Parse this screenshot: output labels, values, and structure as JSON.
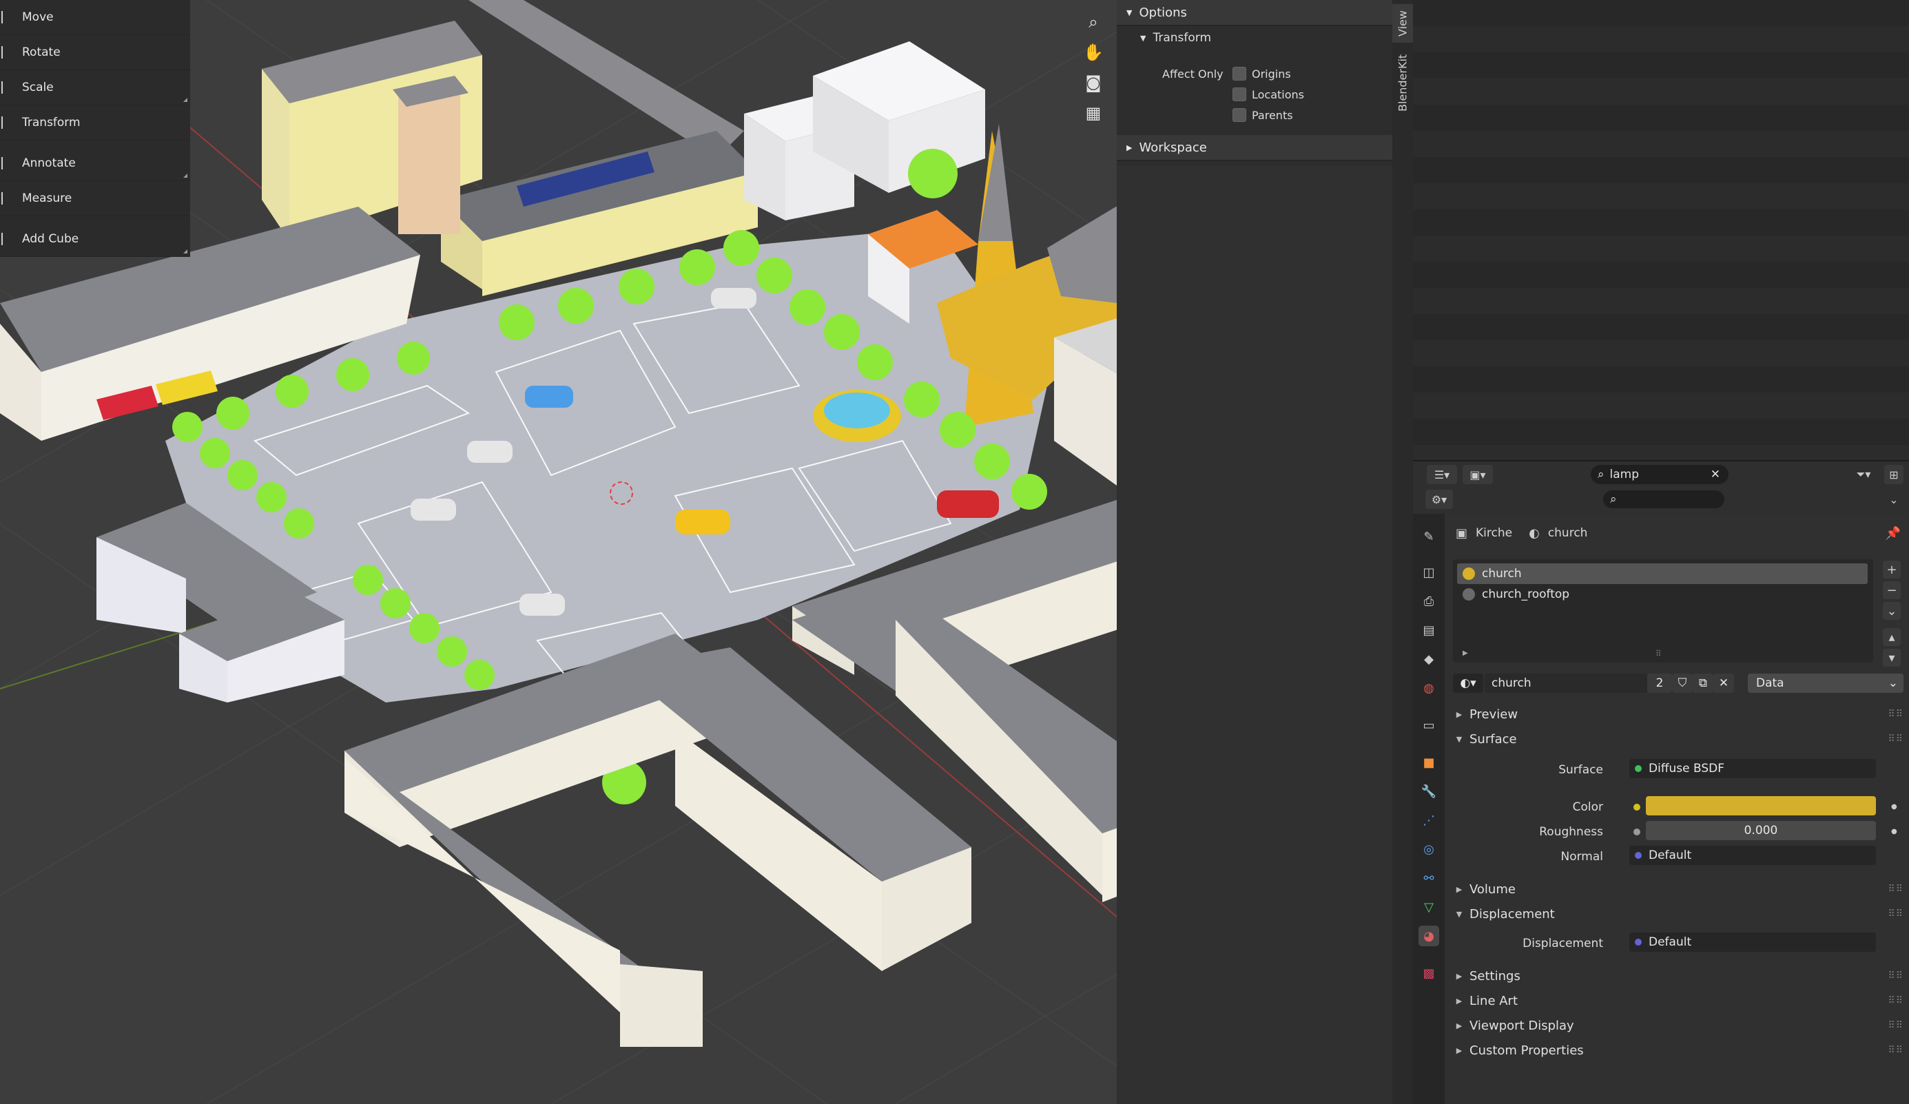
{
  "toolbar": {
    "tools": [
      {
        "label": "Move"
      },
      {
        "label": "Rotate"
      },
      {
        "label": "Scale"
      },
      {
        "label": "Transform"
      },
      {
        "label": "Annotate"
      },
      {
        "label": "Measure"
      },
      {
        "label": "Add Cube"
      }
    ]
  },
  "npanel": {
    "options_label": "Options",
    "transform_label": "Transform",
    "affect_only_label": "Affect Only",
    "checkboxes": [
      {
        "label": "Origins",
        "checked": false
      },
      {
        "label": "Locations",
        "checked": false
      },
      {
        "label": "Parents",
        "checked": false
      }
    ],
    "workspace_label": "Workspace",
    "tabs": [
      "View",
      "BlenderKit"
    ]
  },
  "outliner": {
    "search_value": "lamp"
  },
  "properties": {
    "search_value": "",
    "breadcrumb": {
      "object": "Kirche",
      "material": "church"
    },
    "slots": [
      "church",
      "church_rooftop"
    ],
    "material_name": "church",
    "user_count": "2",
    "link_mode": "Data",
    "sections": {
      "preview": "Preview",
      "surface": "Surface",
      "volume": "Volume",
      "displacement": "Displacement",
      "settings": "Settings",
      "line_art": "Line Art",
      "viewport_display": "Viewport Display",
      "custom_properties": "Custom Properties"
    },
    "surface": {
      "surface_label": "Surface",
      "surface_value": "Diffuse BSDF",
      "color_label": "Color",
      "color_value": "#d4af2b",
      "roughness_label": "Roughness",
      "roughness_value": "0.000",
      "normal_label": "Normal",
      "normal_value": "Default"
    },
    "displacement": {
      "label": "Displacement",
      "value": "Default"
    }
  }
}
